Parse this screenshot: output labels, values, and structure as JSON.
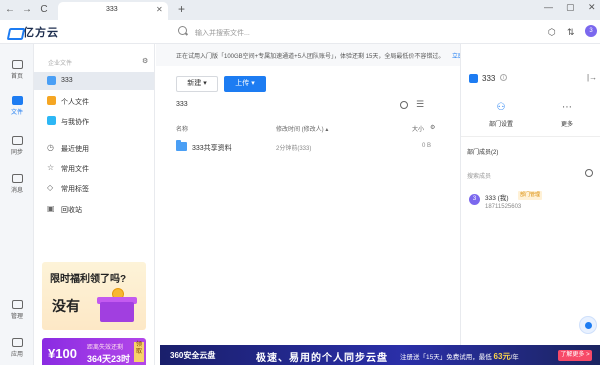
{
  "browser": {
    "tab_title": "333",
    "close": "✕",
    "new_tab": "+",
    "back": "←",
    "forward": "→",
    "refresh": "C",
    "minimize": "—",
    "maximize": "▢",
    "close_window": "✕"
  },
  "header": {
    "app_name": "亿方云",
    "search_placeholder": "输入并搜索文件...",
    "avatar_text": "3"
  },
  "rail": [
    {
      "label": "首页"
    },
    {
      "label": "文件"
    },
    {
      "label": "同步"
    },
    {
      "label": "消息"
    },
    {
      "label": "管理"
    },
    {
      "label": "应用"
    }
  ],
  "sidebar": {
    "section": "企业文件",
    "items": [
      {
        "label": "333",
        "selected": true,
        "color": "#4a9ff5"
      },
      {
        "label": "个人文件",
        "color": "#f5a623"
      },
      {
        "label": "与我协作",
        "color": "#2db7f5"
      }
    ],
    "items2": [
      {
        "label": "最近使用",
        "icon": "◷"
      },
      {
        "label": "常用文件",
        "icon": "☆"
      },
      {
        "label": "常用标签",
        "icon": "◇"
      },
      {
        "label": "回收站",
        "icon": "▣"
      }
    ]
  },
  "promo": {
    "title": "限时福利领了吗?",
    "big": "没有",
    "price": "¥100",
    "t1": "距离失效还剩",
    "t2": "364天23时",
    "tag": "领取"
  },
  "main": {
    "notice": "正在试用入门版「100GB空间+专属加速通道+5人团队账号」，体验还剩 15天，全局最低价不容错过。",
    "notice_link": "立即购买 >",
    "new_button": "新建 ▾",
    "upload_button": "上传 ▾",
    "path": "333",
    "columns": {
      "name": "名称",
      "modified": "修改时间 (修改人) ▴",
      "size": "大小"
    },
    "rows": [
      {
        "name": "333共享资料",
        "modified": "2分钟前(333)",
        "size": "0 B"
      }
    ]
  },
  "right_panel": {
    "title": "333",
    "info": "i",
    "collapse": "|→",
    "action_dept": "部门设置",
    "action_more": "更多",
    "members_heading": "部门成员(2)",
    "search_placeholder": "搜索成员",
    "member_name": "333 (我)",
    "member_badge": "部门管理",
    "member_phone": "18711525603",
    "member_avatar": "3"
  },
  "adbar": {
    "logo": "360安全云盘",
    "slogan": "极速、易用的个人同步云盘",
    "offer_prefix": "注册送「15天」免费试用，最低",
    "price": "63元",
    "offer_suffix": "/年",
    "more": "了解更多 >"
  },
  "colors": {
    "accent": "#1d7cf2",
    "selected_bg": "#e6eaf0"
  }
}
